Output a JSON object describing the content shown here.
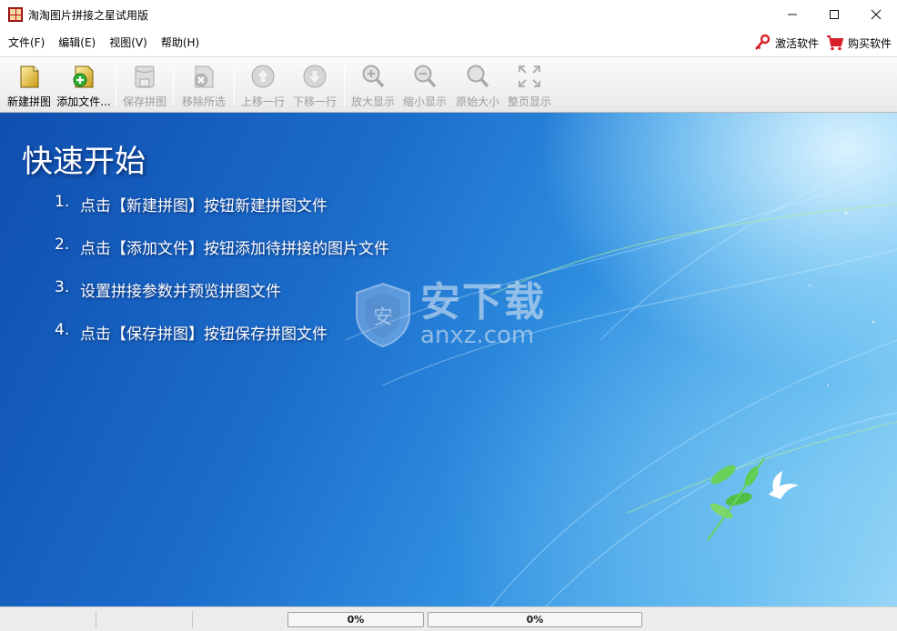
{
  "window": {
    "title": "淘淘图片拼接之星试用版",
    "controls": {
      "minimize": "minimize",
      "maximize": "maximize",
      "close": "close"
    }
  },
  "menu": {
    "items": [
      "文件(F)",
      "编辑(E)",
      "视图(V)",
      "帮助(H)"
    ],
    "activate_label": "激活软件",
    "buy_label": "购买软件"
  },
  "toolbar": {
    "buttons": [
      {
        "label": "新建拼图",
        "icon": "new-collage-icon",
        "enabled": true
      },
      {
        "label": "添加文件...",
        "icon": "add-file-icon",
        "enabled": true
      },
      {
        "label": "保存拼图",
        "icon": "save-collage-icon",
        "enabled": false
      },
      {
        "label": "移除所选",
        "icon": "remove-selected-icon",
        "enabled": false
      },
      {
        "label": "上移一行",
        "icon": "move-up-icon",
        "enabled": false
      },
      {
        "label": "下移一行",
        "icon": "move-down-icon",
        "enabled": false
      },
      {
        "label": "放大显示",
        "icon": "zoom-in-icon",
        "enabled": false
      },
      {
        "label": "缩小显示",
        "icon": "zoom-out-icon",
        "enabled": false
      },
      {
        "label": "原始大小",
        "icon": "actual-size-icon",
        "enabled": false
      },
      {
        "label": "整页显示",
        "icon": "fit-page-icon",
        "enabled": false
      }
    ]
  },
  "quickstart": {
    "title": "快速开始",
    "steps": [
      {
        "num": "1.",
        "text": "点击【新建拼图】按钮新建拼图文件"
      },
      {
        "num": "2.",
        "text": "点击【添加文件】按钮添加待拼接的图片文件"
      },
      {
        "num": "3.",
        "text": "设置拼接参数并预览拼图文件"
      },
      {
        "num": "4.",
        "text": "点击【保存拼图】按钮保存拼图文件"
      }
    ]
  },
  "watermark": {
    "cn": "安下载",
    "en": "anxz.com",
    "shield_char": "安"
  },
  "status": {
    "progress1": {
      "label": "0%",
      "value": 0
    },
    "progress2": {
      "label": "0%",
      "value": 0
    }
  },
  "colors": {
    "accent_blue": "#1b6ccb",
    "progress_fill": "#41b636",
    "disabled_text": "#9c9c9c"
  }
}
